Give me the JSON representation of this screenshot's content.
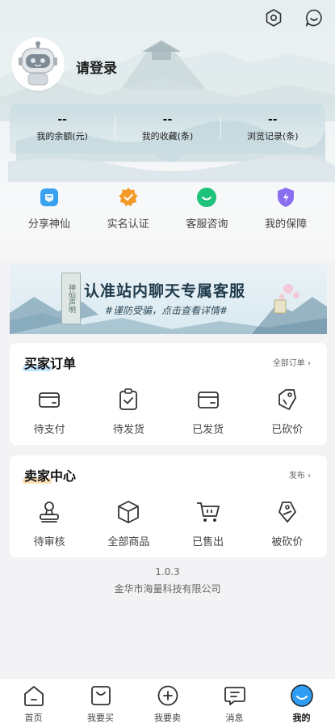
{
  "profile": {
    "login_text": "请登录"
  },
  "stats": [
    {
      "value": "--",
      "label": "我的余额(元)"
    },
    {
      "value": "--",
      "label": "我的收藏(条)"
    },
    {
      "value": "--",
      "label": "浏览记录(条)"
    }
  ],
  "quick_actions": [
    {
      "label": "分享神仙",
      "icon": "share-icon",
      "color": "#3aa0f0"
    },
    {
      "label": "实名认证",
      "icon": "verify-badge-icon",
      "color": "#f39a2a"
    },
    {
      "label": "客服咨询",
      "icon": "chat-icon",
      "color": "#1fc27a"
    },
    {
      "label": "我的保障",
      "icon": "shield-icon",
      "color": "#8a6ef0"
    }
  ],
  "banner": {
    "title": "认准站内聊天专属客服",
    "subtitle": "#谨防受骗，点击查看详情#",
    "tag": "神仙声明"
  },
  "buyer_orders": {
    "title": "买家订单",
    "link": "全部订单",
    "items": [
      {
        "label": "待支付",
        "icon": "wallet-icon"
      },
      {
        "label": "待发货",
        "icon": "clipboard-check-icon"
      },
      {
        "label": "已发货",
        "icon": "card-icon"
      },
      {
        "label": "已砍价",
        "icon": "price-tag-icon"
      }
    ]
  },
  "seller_center": {
    "title": "卖家中心",
    "link": "发布",
    "items": [
      {
        "label": "待审核",
        "icon": "stamp-icon"
      },
      {
        "label": "全部商品",
        "icon": "box-icon"
      },
      {
        "label": "已售出",
        "icon": "cart-icon"
      },
      {
        "label": "被砍价",
        "icon": "tag-cut-icon"
      }
    ]
  },
  "footer": {
    "version": "1.0.3",
    "company": "金华市海量科技有限公司"
  },
  "tabbar": [
    {
      "label": "首页",
      "icon": "home-icon",
      "active": false
    },
    {
      "label": "我要买",
      "icon": "bag-icon",
      "active": false
    },
    {
      "label": "我要卖",
      "icon": "plus-circle-icon",
      "active": false
    },
    {
      "label": "消息",
      "icon": "message-icon",
      "active": false
    },
    {
      "label": "我的",
      "icon": "profile-face-icon",
      "active": true
    }
  ],
  "colors": {
    "accent_blue": "#2f9df4",
    "buyer_highlight": "#bfe3fb",
    "seller_highlight": "#fde0b5"
  }
}
